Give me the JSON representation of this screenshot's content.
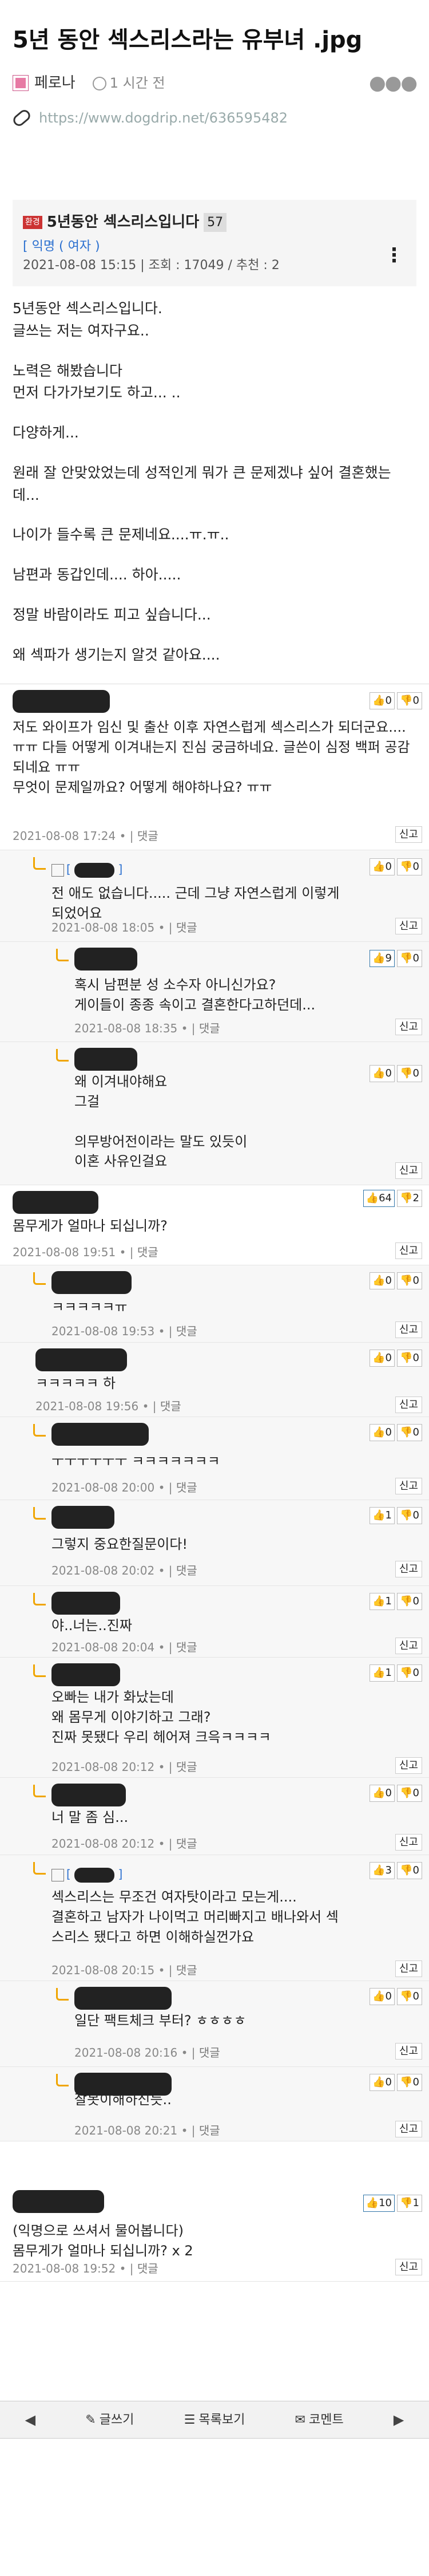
{
  "header": {
    "title": "5년 동안 섹스리스라는 유부녀 .jpg",
    "user": "페로나",
    "time": "1 시간 전",
    "url": "https://www.dogdrip.net/636595482"
  },
  "post": {
    "badge": "환경",
    "title": "5년동안 섹스리스입니다",
    "count": "57",
    "author_prefix": "[ ",
    "author": "익명",
    "author_suffix": " ( 여자 )",
    "info": "2021-08-08 15:15 | 조회 : 17049 / 추천 : 2",
    "body": [
      "5년동안 섹스리스입니다.\n글쓰는 저는 여자구요..",
      "노력은 해봤습니다\n먼저 다가가보기도 하고... ..",
      "다양하게...",
      "원래 잘 안맞았었는데 성적인게 뭐가 큰 문제겠냐 싶어 결혼했는데...",
      "나이가 들수록 큰 문제네요....ㅠ.ㅠ..",
      "남편과 동갑인데.... 하아.....",
      "정말 바람이라도 피고 싶습니다...",
      "왜 섹파가 생기는지 알것 같아요...."
    ]
  },
  "comments": [
    {
      "text": "저도 와이프가 임신 및 출산 이후 자연스럽게 섹스리스가 되더군요....ㅠㅠ 다들 어떻게 이겨내는지 진심 궁금하네요. 글쓴이 심정 백퍼 공감되네요 ㅠㅠ\n무엇이 문제일까요? 어떻게 해야하나요? ㅠㅠ",
      "date": "2021-08-08 17:24",
      "up": "0",
      "down": "0"
    },
    {
      "text": "전 애도 없습니다..... 근데 그냥 자연스럽게 이렇게 되었어요",
      "date": "2021-08-08 18:05",
      "up": "0",
      "down": "0",
      "anon": "[ ",
      "anon_end": " ]"
    },
    {
      "text": "혹시 남편분 성 소수자 아니신가요?\n게이들이 종종 속이고 결혼한다고하던데...",
      "date": "2021-08-08 18:35",
      "up": "9",
      "down": "0"
    },
    {
      "text": "왜 이겨내야해요\n그걸\n\n의무방어전이라는 말도 있듯이\n이혼 사유인걸요",
      "up": "0",
      "down": "0"
    },
    {
      "text": "몸무게가 얼마나 되십니까?",
      "date": "2021-08-08 19:51",
      "up": "64",
      "down": "2"
    },
    {
      "text": "ㅋㅋㅋㅋㅋㅠ",
      "date": "2021-08-08 19:53",
      "up": "0",
      "down": "0"
    },
    {
      "text": "ㅋㅋㅋㅋㅋ 하",
      "date": "2021-08-08 19:56",
      "up": "0",
      "down": "0"
    },
    {
      "text": "ㅜㅜㅜㅜㅜㅜ ㅋㅋㅋㅋㅋㅋㅋ",
      "date": "2021-08-08 20:00",
      "up": "0",
      "down": "0"
    },
    {
      "text": "그렇지 중요한질문이다!",
      "date": "2021-08-08 20:02",
      "up": "1",
      "down": "0"
    },
    {
      "text": "야..너는..진짜",
      "date": "2021-08-08 20:04",
      "up": "1",
      "down": "0"
    },
    {
      "text": "오빠는 내가 화났는데\n왜 몸무게 이야기하고 그래?\n진짜 못됐다 우리 헤어져 크윽ㅋㅋㅋㅋ",
      "date": "2021-08-08 20:12",
      "up": "1",
      "down": "0"
    },
    {
      "text": "너 말 좀 심...",
      "date": "2021-08-08 20:12",
      "up": "0",
      "down": "0"
    },
    {
      "text": "섹스리스는 무조건 여자탓이라고 모는게....\n결혼하고 남자가 나이먹고 머리빠지고 배나와서 섹스리스 됐다고 하면 이해하실껀가요",
      "date": "2021-08-08 20:15",
      "up": "3",
      "down": "0",
      "anon": "[ ",
      "anon_end": " ]"
    },
    {
      "text": "일단 팩트체크 부터? ㅎㅎㅎㅎ",
      "date": "2021-08-08 20:16",
      "up": "0",
      "down": "0"
    },
    {
      "text": "잘못이해하신듯..",
      "date": "2021-08-08 20:21",
      "up": "0",
      "down": "0"
    },
    {
      "text": "(익명으로 쓰셔서 물어봅니다)\n몸무게가 얼마나 되십니까? x 2",
      "date": "2021-08-08 19:52",
      "up": "10",
      "down": "1"
    }
  ],
  "labels": {
    "reply": "댓글",
    "report": "신고",
    "dot": "•",
    "sep": "|"
  },
  "nav": {
    "write": "글쓰기",
    "list": "목록보기",
    "comment": "코멘트"
  }
}
